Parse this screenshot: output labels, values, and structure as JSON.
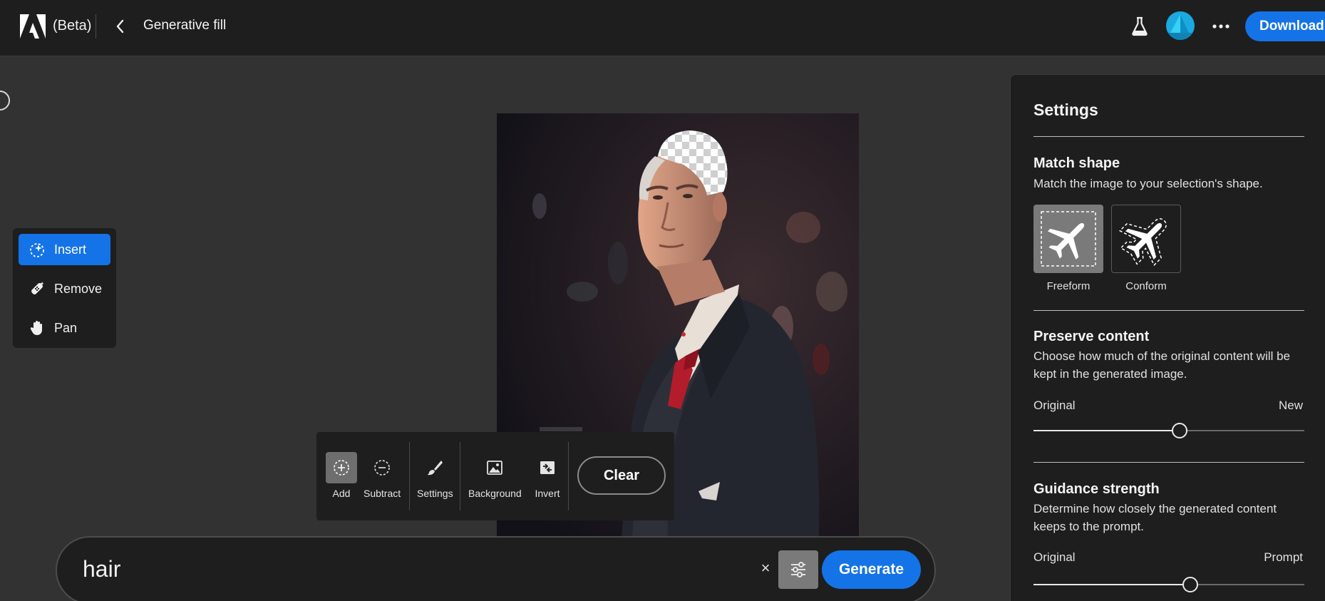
{
  "header": {
    "beta_label": "(Beta)",
    "title": "Generative fill",
    "download_label": "Download"
  },
  "tools": [
    {
      "label": "Insert",
      "icon": "insert-sparkle-icon",
      "active": true
    },
    {
      "label": "Remove",
      "icon": "remove-bandage-icon",
      "active": false
    },
    {
      "label": "Pan",
      "icon": "hand-icon",
      "active": false
    }
  ],
  "selection_toolbar": {
    "add_label": "Add",
    "subtract_label": "Subtract",
    "settings_label": "Settings",
    "background_label": "Background",
    "invert_label": "Invert",
    "clear_label": "Clear"
  },
  "prompt": {
    "value": "hair",
    "clear_symbol": "×",
    "generate_label": "Generate"
  },
  "settings": {
    "title": "Settings",
    "match_shape": {
      "heading": "Match shape",
      "description": "Match the image to your selection's shape.",
      "options": [
        {
          "label": "Freeform",
          "selected": true
        },
        {
          "label": "Conform",
          "selected": false
        }
      ]
    },
    "preserve_content": {
      "heading": "Preserve content",
      "description": "Choose how much of the original content will be kept in the generated image.",
      "min_label": "Original",
      "max_label": "New",
      "value": 0.54
    },
    "guidance_strength": {
      "heading": "Guidance strength",
      "description": "Determine how closely the generated content keeps to the prompt.",
      "min_label": "Original",
      "max_label": "Prompt",
      "value": 0.58
    }
  },
  "colors": {
    "accent": "#1473e6",
    "topbar": "#1e1e1e",
    "canvas": "#323232"
  }
}
